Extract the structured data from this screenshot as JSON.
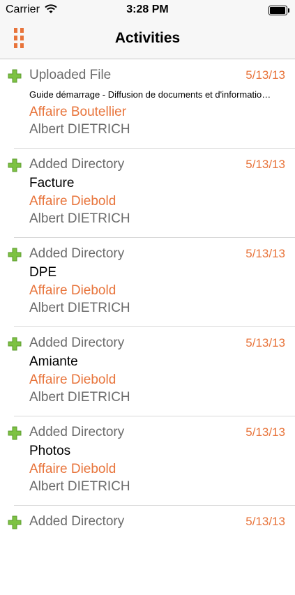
{
  "status_bar": {
    "carrier": "Carrier",
    "time": "3:28 PM"
  },
  "nav": {
    "title": "Activities",
    "menu_icon": "grid-menu-icon"
  },
  "colors": {
    "accent": "#e8743b",
    "plus_green": "#7dc242",
    "secondary_text": "#6b6b6b"
  },
  "activities": [
    {
      "action": "Uploaded File",
      "date": "5/13/13",
      "item": "Guide démarrage - Diffusion de documents et d'informatio…",
      "affaire": "Affaire Boutellier",
      "person": "Albert DIETRICH"
    },
    {
      "action": "Added Directory",
      "date": "5/13/13",
      "item": "Facture",
      "affaire": "Affaire Diebold",
      "person": "Albert DIETRICH"
    },
    {
      "action": "Added Directory",
      "date": "5/13/13",
      "item": "DPE",
      "affaire": "Affaire Diebold",
      "person": "Albert DIETRICH"
    },
    {
      "action": "Added Directory",
      "date": "5/13/13",
      "item": "Amiante",
      "affaire": "Affaire Diebold",
      "person": "Albert DIETRICH"
    },
    {
      "action": "Added Directory",
      "date": "5/13/13",
      "item": "Photos",
      "affaire": "Affaire Diebold",
      "person": "Albert DIETRICH"
    },
    {
      "action": "Added Directory",
      "date": "5/13/13",
      "item": "",
      "affaire": "",
      "person": ""
    }
  ]
}
